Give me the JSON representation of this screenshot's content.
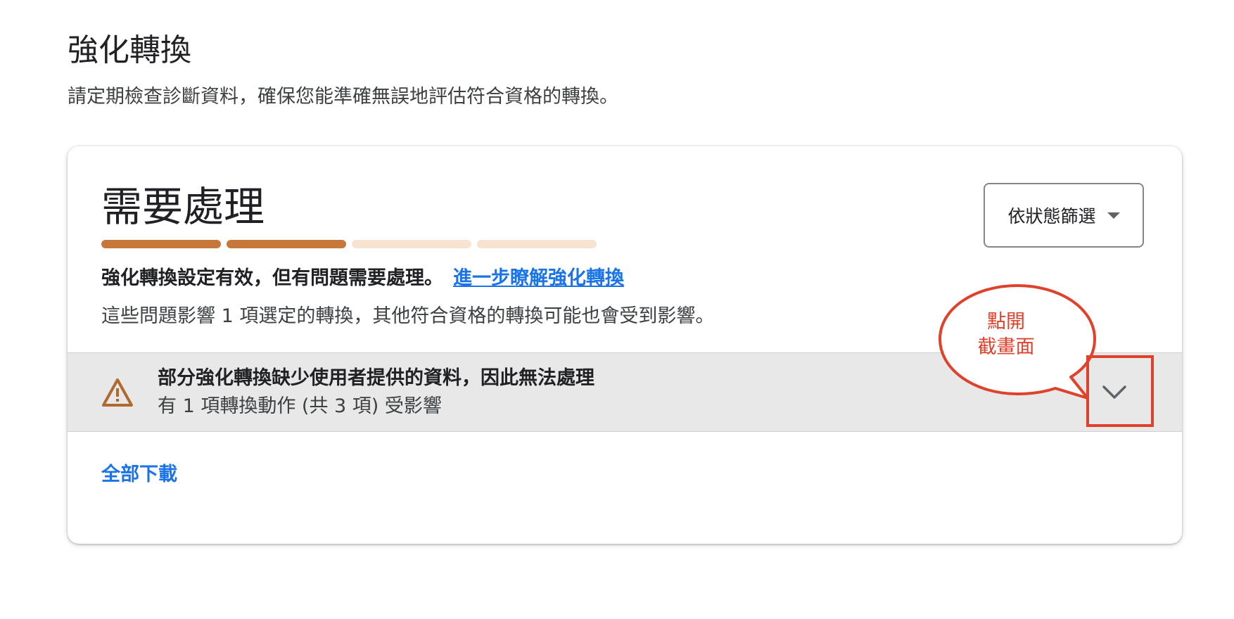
{
  "header": {
    "title": "強化轉換",
    "subtitle": "請定期檢查診斷資料，確保您能準確無誤地評估符合資格的轉換。"
  },
  "card": {
    "title": "需要處理",
    "progress": {
      "filled_segments": 2,
      "total_segments": 4,
      "filled_color": "#c8773a",
      "empty_color": "#f8e2d0"
    },
    "status_text": "強化轉換設定有效，但有問題需要處理。",
    "learn_more_link": "進一步瞭解強化轉換",
    "impact_text": "這些問題影響 1 項選定的轉換，其他符合資格的轉換可能也會受到影響。",
    "filter": {
      "label": "依狀態篩選",
      "icon": "dropdown-caret-icon"
    },
    "issue": {
      "icon": "warning-icon",
      "icon_color": "#b06a2f",
      "title": "部分強化轉換缺少使用者提供的資料，因此無法處理",
      "subtitle": "有 1 項轉換動作 (共 3 項) 受影響",
      "expand_icon": "chevron-down-icon"
    },
    "download_all": "全部下載"
  },
  "annotation": {
    "callout_text_line1": "點開",
    "callout_text_line2": "截畫面",
    "color": "#e0412b"
  }
}
